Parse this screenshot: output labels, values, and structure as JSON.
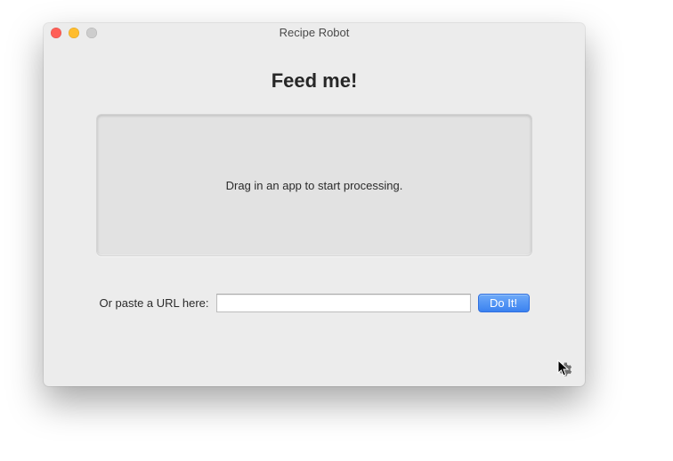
{
  "window": {
    "title": "Recipe Robot"
  },
  "main": {
    "heading": "Feed me!",
    "dropzone_text": "Drag in an app to start processing.",
    "url_label": "Or paste a URL here:",
    "url_value": "",
    "url_placeholder": "",
    "doit_label": "Do It!"
  },
  "icons": {
    "gear": "gear-icon",
    "cursor": "mouse-cursor"
  },
  "colors": {
    "window_bg": "#ececec",
    "accent": "#3b82f0"
  }
}
